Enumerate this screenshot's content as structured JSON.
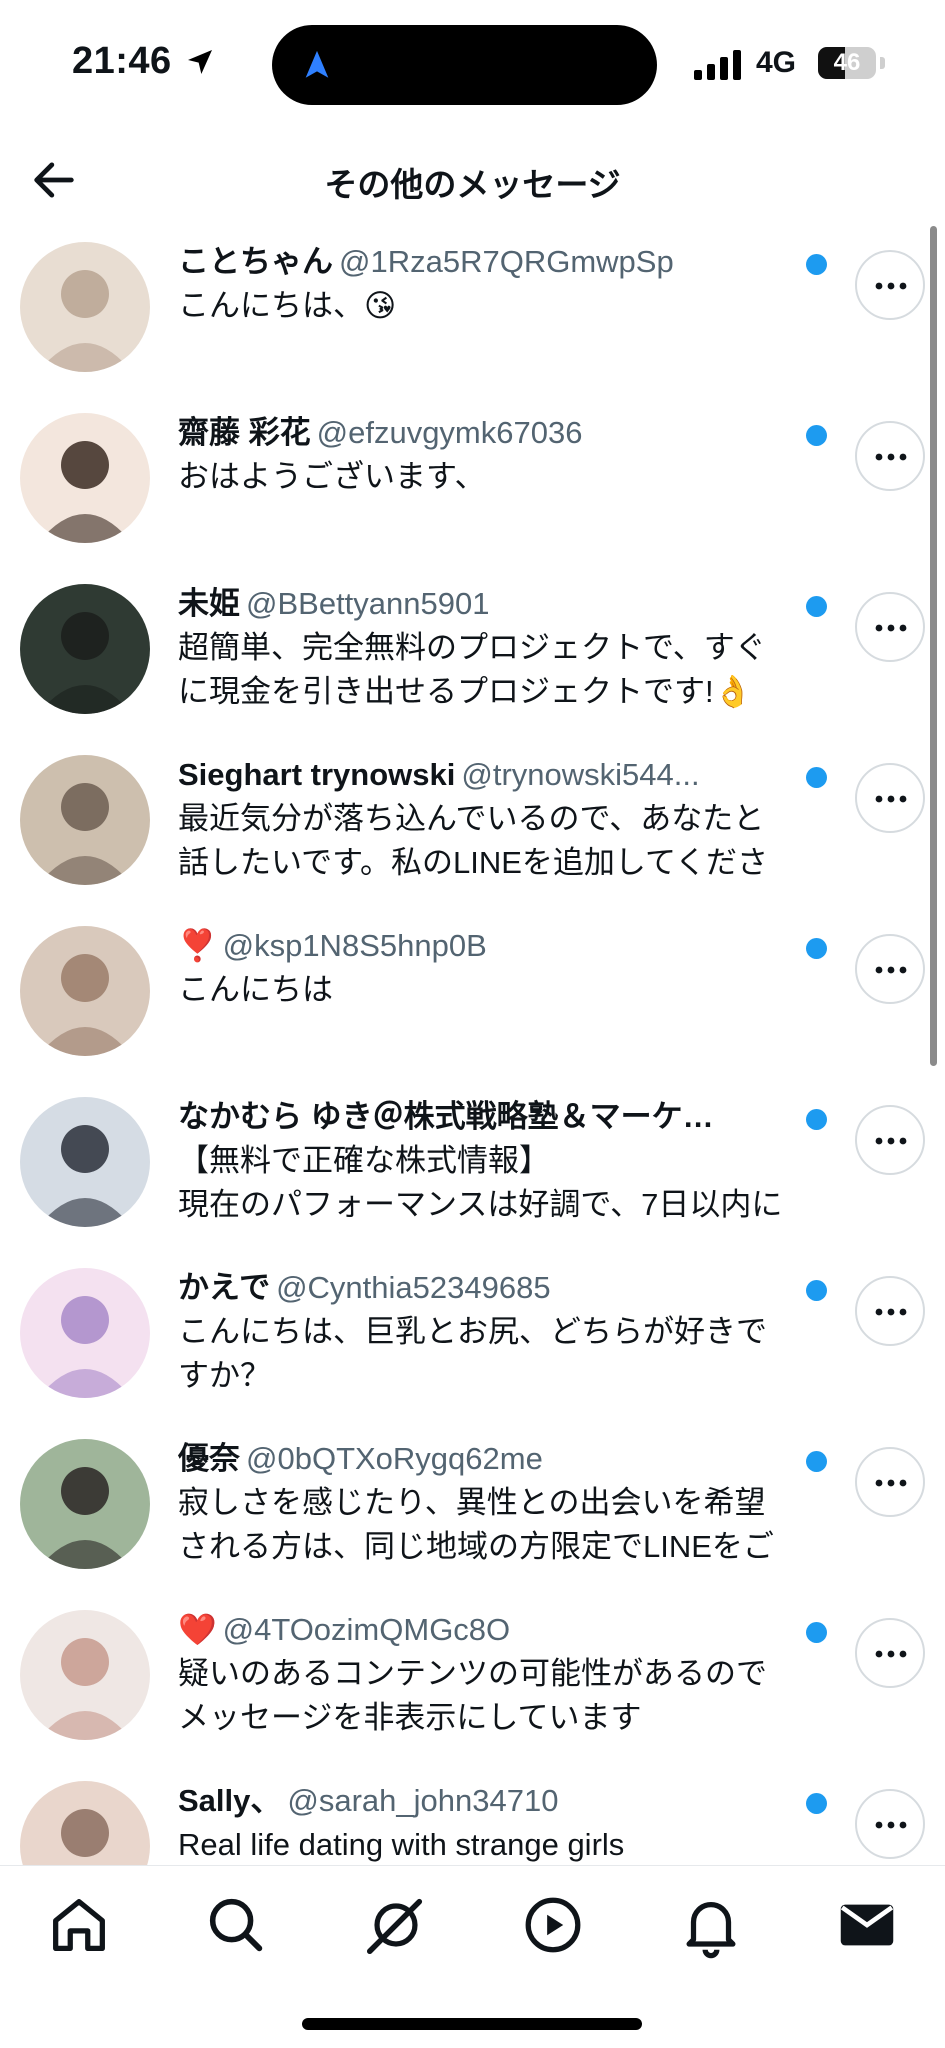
{
  "status_bar": {
    "time": "21:46",
    "network": "4G",
    "battery_level": "46"
  },
  "header": {
    "title": "その他のメッセージ"
  },
  "messages": [
    {
      "name": "ことちゃん",
      "handle": "@1Rza5R7QRGmwpSp",
      "lines": [
        "こんにちは、😘"
      ]
    },
    {
      "name": "齋藤 彩花",
      "handle": "@efzuvgymk67036",
      "lines": [
        "おはようございます、"
      ]
    },
    {
      "name": "未姫",
      "handle": "@BBettyann5901",
      "lines": [
        "超簡単、完全無料のプロジェクトで、すぐ",
        "に現金を引き出せるプロジェクトです!👌"
      ]
    },
    {
      "name": "Sieghart trynowski",
      "handle": "@trynowski544...",
      "lines": [
        "最近気分が落ち込んでいるので、あなたと",
        "話したいです。私のLINEを追加してくださ"
      ]
    },
    {
      "name": "❣️",
      "handle": "@ksp1N8S5hnp0B",
      "lines": [
        "こんにちは"
      ]
    },
    {
      "name": "なかむら ゆき＠株式戦略塾＆マーケ…",
      "handle": "",
      "lines": [
        "【無料で正確な株式情報】",
        "現在のパフォーマンスは好調で、7日以内に"
      ]
    },
    {
      "name": "かえで",
      "handle": "@Cynthia52349685",
      "lines": [
        "こんにちは、巨乳とお尻、どちらが好きで",
        "すか？"
      ]
    },
    {
      "name": "優奈",
      "handle": "@0bQTXoRygq62me",
      "lines": [
        "寂しさを感じたり、異性との出会いを希望",
        "される方は、同じ地域の方限定でLINEをご"
      ]
    },
    {
      "name": "❤️",
      "handle": "@4TOozimQMGc8O",
      "lines": [
        "疑いのあるコンテンツの可能性があるので",
        "メッセージを非表示にしています"
      ]
    },
    {
      "name": "Sally、",
      "handle": "@sarah_john34710",
      "lines": [
        "Real life dating with strange girls"
      ]
    }
  ],
  "tabbar": {
    "items": [
      "home-icon",
      "search-icon",
      "grok-icon",
      "video-icon",
      "bell-icon",
      "mail-icon"
    ]
  },
  "colors": {
    "unread_dot": "#1d9bf0",
    "handle": "#536471",
    "text": "#0f1419"
  }
}
